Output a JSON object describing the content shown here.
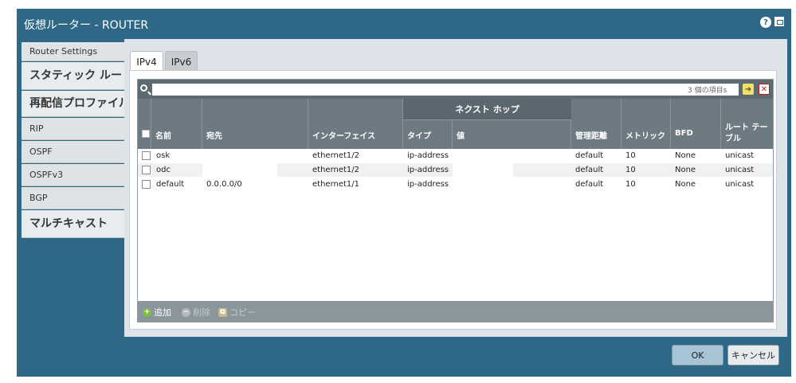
{
  "window": {
    "title": "仮想ルーター - ROUTER",
    "help_icon": "help-icon",
    "maximize_icon": "maximize-icon"
  },
  "sidebar": {
    "items": [
      {
        "label": "Router Settings",
        "size": "small"
      },
      {
        "label": "スタティック ルート",
        "size": "big"
      },
      {
        "label": "再配信プロファイル",
        "size": "big"
      },
      {
        "label": "RIP",
        "size": "small"
      },
      {
        "label": "OSPF",
        "size": "small"
      },
      {
        "label": "OSPFv3",
        "size": "small"
      },
      {
        "label": "BGP",
        "size": "small"
      },
      {
        "label": "マルチキャスト",
        "size": "big"
      }
    ]
  },
  "tabs": [
    {
      "label": "IPv4",
      "active": true
    },
    {
      "label": "IPv6",
      "active": false
    }
  ],
  "search": {
    "placeholder": "",
    "count": "3 個の項目s"
  },
  "table": {
    "group_header": "ネクスト ホップ",
    "columns": [
      "名前",
      "宛先",
      "インターフェイス",
      "タイプ",
      "値",
      "管理距離",
      "メトリック",
      "BFD",
      "ルート テーブル"
    ],
    "rows": [
      [
        "osk",
        "",
        "ethernet1/2",
        "ip-address",
        "",
        "default",
        "10",
        "None",
        "unicast"
      ],
      [
        "odc",
        "",
        "ethernet1/2",
        "ip-address",
        "",
        "default",
        "10",
        "None",
        "unicast"
      ],
      [
        "default",
        "0.0.0.0/0",
        "ethernet1/1",
        "ip-address",
        "",
        "default",
        "10",
        "None",
        "unicast"
      ]
    ]
  },
  "footer": {
    "add": "追加",
    "delete": "削除",
    "copy": "コピー"
  },
  "buttons": {
    "ok": "OK",
    "cancel": "キャンセル"
  },
  "colors": {
    "dialog": "#2f6887",
    "header": "#6d7a82",
    "ok": "#a7c3d6"
  }
}
